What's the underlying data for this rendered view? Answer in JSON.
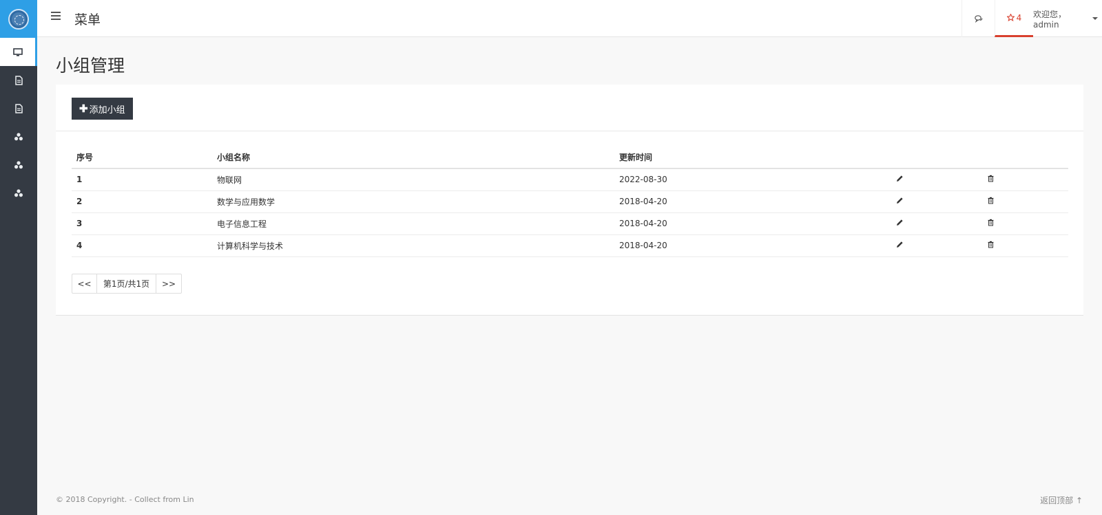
{
  "topbar": {
    "menu_title": "菜单",
    "notification_count": "4",
    "user_greeting": "欢迎您，admin"
  },
  "sidebar": {
    "items": [
      {
        "icon": "desktop-icon",
        "active": true
      },
      {
        "icon": "document-icon",
        "active": false
      },
      {
        "icon": "document-icon",
        "active": false
      },
      {
        "icon": "cubes-icon",
        "active": false
      },
      {
        "icon": "cubes-icon",
        "active": false
      },
      {
        "icon": "cubes-icon",
        "active": false
      }
    ]
  },
  "page": {
    "title": "小组管理",
    "add_button": "添加小组"
  },
  "table": {
    "headers": [
      "序号",
      "小组名称",
      "更新时间",
      "",
      ""
    ],
    "rows": [
      {
        "index": "1",
        "name": "物联网",
        "updated": "2022-08-30"
      },
      {
        "index": "2",
        "name": "数学与应用数学",
        "updated": "2018-04-20"
      },
      {
        "index": "3",
        "name": "电子信息工程",
        "updated": "2018-04-20"
      },
      {
        "index": "4",
        "name": "计算机科学与技术",
        "updated": "2018-04-20"
      }
    ]
  },
  "pager": {
    "prev": "<<",
    "info": "第1页/共1页",
    "next": ">>"
  },
  "footer": {
    "copyright": "© 2018 Copyright. - Collect from Lin",
    "back_to_top": "返回顶部"
  },
  "colors": {
    "sidebar_bg": "#343a43",
    "logo_bg": "#2e9fe6",
    "accent_red": "#d9402e"
  }
}
